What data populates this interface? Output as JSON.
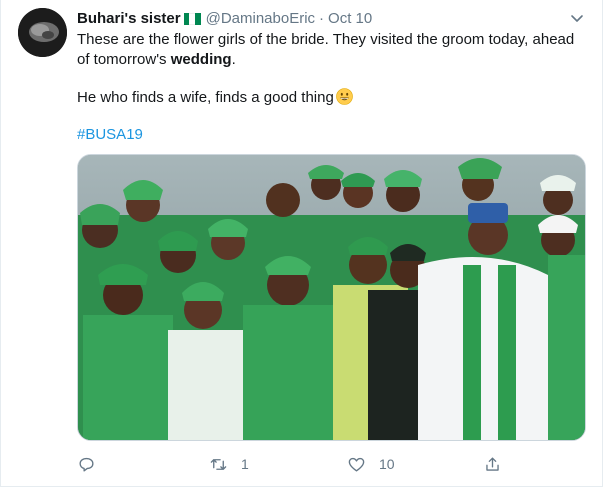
{
  "tweet": {
    "display_name": "Buhari's sister",
    "handle": "@DaminaboEric",
    "separator": "·",
    "date": "Oct 10",
    "text_line1": "These are the flower girls of the bride. They visited the groom today, ahead",
    "text_line2_prefix": "of tomorrow's ",
    "text_line2_bold": "wedding",
    "text_line2_suffix": ".",
    "text_line3": "He who finds a wife, finds a good thing",
    "hashtag": "#BUSA19",
    "flag_icon": "nigeria-flag-icon",
    "emoji_icon": "grinning-face-icon"
  },
  "actions": {
    "reply_count": "",
    "retweet_count": "1",
    "like_count": "10",
    "share_count": ""
  },
  "colors": {
    "link": "#1b95e0",
    "muted": "#657786",
    "text": "#14171a",
    "flag_green": "#008751",
    "flag_white": "#ffffff"
  }
}
